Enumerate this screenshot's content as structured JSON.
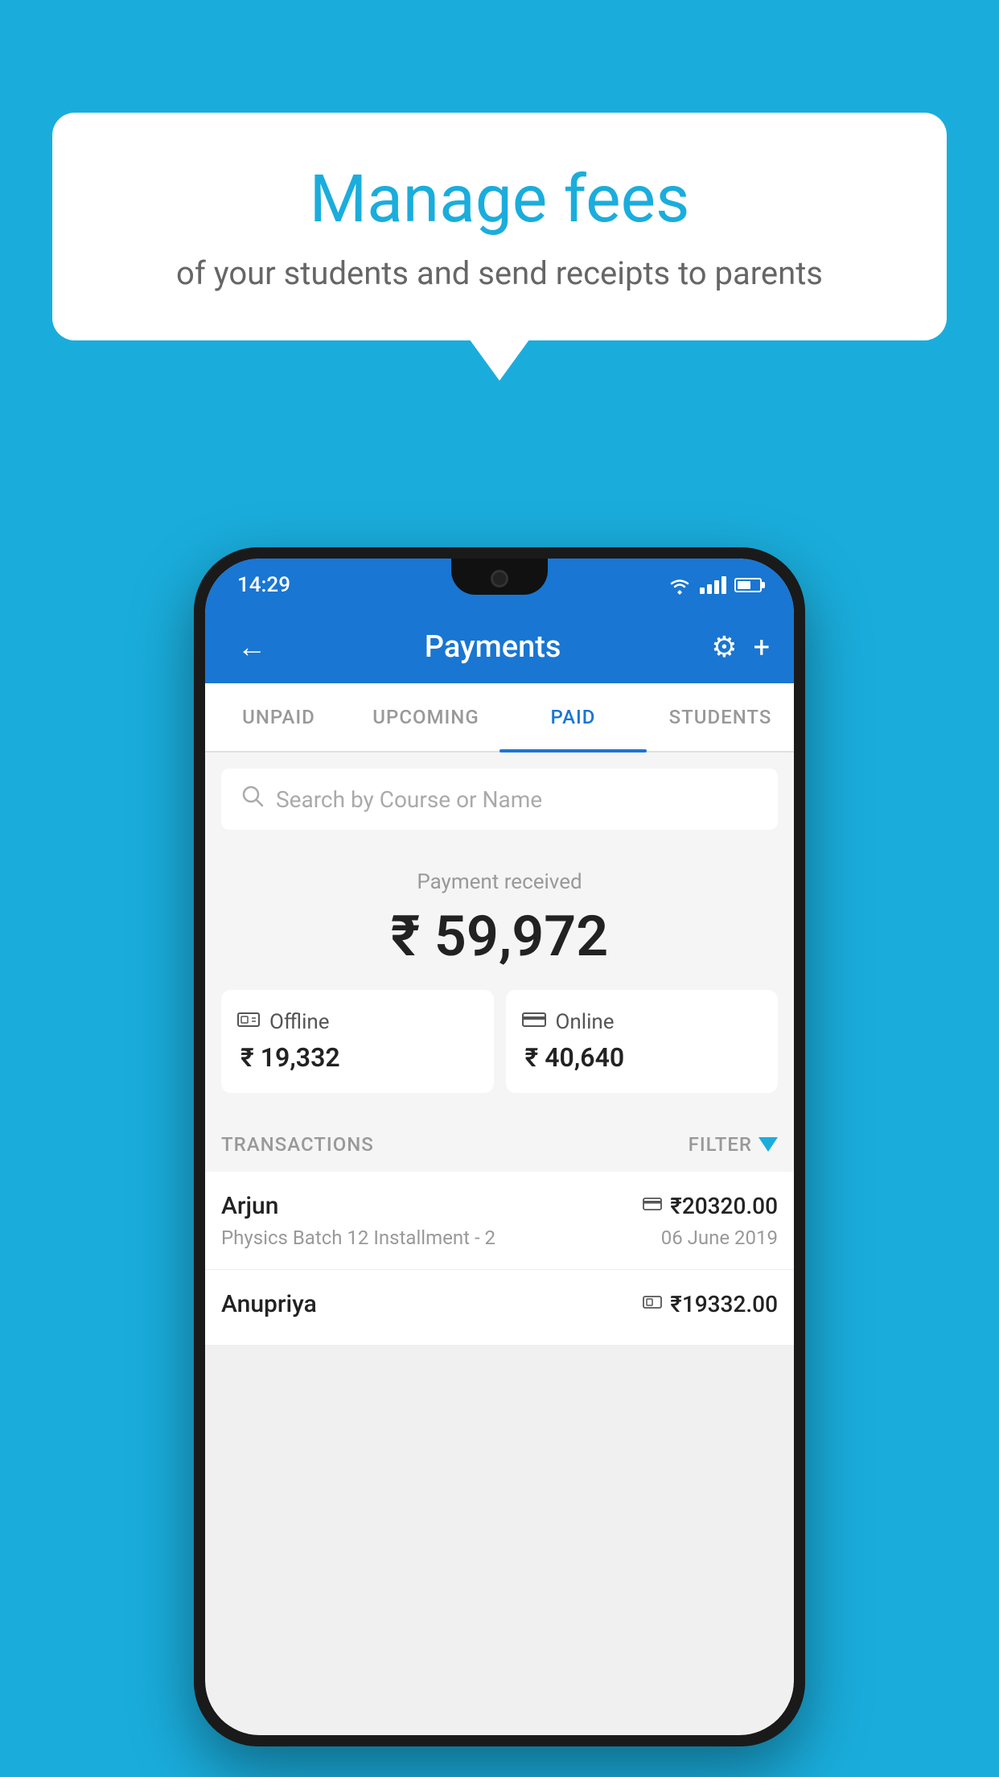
{
  "background_color": "#1AADDC",
  "speech_bubble": {
    "title": "Manage fees",
    "subtitle": "of your students and send receipts to parents"
  },
  "status_bar": {
    "time": "14:29"
  },
  "app_bar": {
    "title": "Payments",
    "back_label": "←",
    "gear_label": "⚙",
    "plus_label": "+"
  },
  "tabs": [
    {
      "id": "unpaid",
      "label": "UNPAID",
      "active": false
    },
    {
      "id": "upcoming",
      "label": "UPCOMING",
      "active": false
    },
    {
      "id": "paid",
      "label": "PAID",
      "active": true
    },
    {
      "id": "students",
      "label": "STUDENTS",
      "active": false
    }
  ],
  "search": {
    "placeholder": "Search by Course or Name"
  },
  "payment_summary": {
    "received_label": "Payment received",
    "total_amount": "₹ 59,972",
    "offline": {
      "label": "Offline",
      "amount": "₹ 19,332"
    },
    "online": {
      "label": "Online",
      "amount": "₹ 40,640"
    }
  },
  "transactions_section": {
    "header_label": "TRANSACTIONS",
    "filter_label": "FILTER"
  },
  "transactions": [
    {
      "name": "Arjun",
      "description": "Physics Batch 12 Installment - 2",
      "amount": "₹20320.00",
      "date": "06 June 2019",
      "mode": "card"
    },
    {
      "name": "Anupriya",
      "description": "",
      "amount": "₹19332.00",
      "date": "",
      "mode": "cash"
    }
  ]
}
